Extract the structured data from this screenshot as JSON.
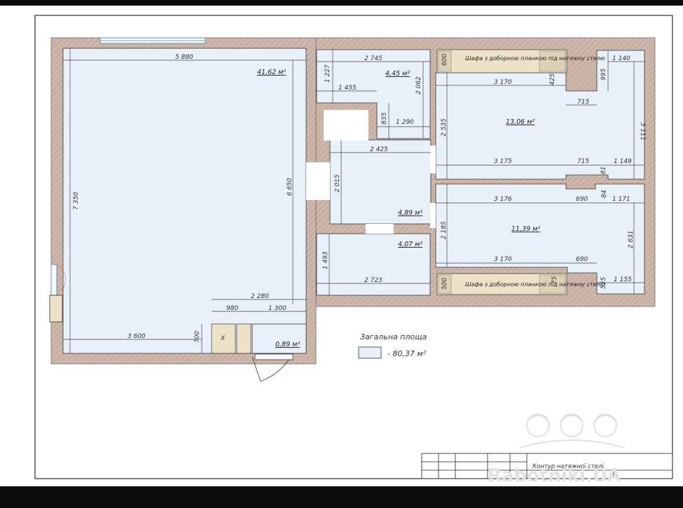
{
  "colors": {
    "wall": "#c9b2a6",
    "room": "#e8f0fa",
    "wardrobe": "#ede2c8",
    "dim_line": "#444444",
    "frame": "#000000"
  },
  "rooms": {
    "living": {
      "area": "41,62 м²",
      "w_top": "5 880",
      "h_left": "7 350",
      "h_right": "6 650",
      "w_bottom": "3 600",
      "step_w": "2 280",
      "step_a": "980",
      "step_b": "1 300",
      "step_h": "700",
      "closet_mark": "X"
    },
    "room_a": {
      "area": "4,45 м²",
      "w_top": "2 745",
      "h_left": "1 227",
      "w_mid": "1 455",
      "h_right": "2 062",
      "h_notch": "835",
      "w_bottom": "1 290"
    },
    "room_b": {
      "area": "4,89 м²",
      "w_top": "2 425",
      "h_left": "2 015"
    },
    "room_c": {
      "area": "4,07 м²",
      "h_left": "1 493",
      "w_bottom": "2 723"
    },
    "bed1": {
      "area": "13,06 м²",
      "wardrobe_h": "600",
      "wardrobe_text": "Шафа з доборною планкою під натяжну стелю",
      "w_top": "3 170",
      "notch_h": "425",
      "right_w": "1 140",
      "right_h": "995",
      "notch_w": "715",
      "h_right": "3 111",
      "h_left": "2 535",
      "w_bottom": "3 175",
      "b_notch_w": "715",
      "b_right_w": "1 149",
      "b_notch_h": "81"
    },
    "bed2": {
      "area": "11,39 м²",
      "w_top": "3 176",
      "notch_w": "690",
      "notch_h": "84",
      "right_w": "1 171",
      "h_left": "2 185",
      "h_right": "2 631",
      "w_bottom": "3 170",
      "b_notch_w": "690",
      "wardrobe_h": "500",
      "wardrobe_text": "Шафа з доборною планкою під натяжну стелю",
      "b_notch_h": "75",
      "b_right_h": "525",
      "b_right_w": "1 155"
    },
    "small": {
      "area": "0,89 м²"
    }
  },
  "legend": {
    "title": "Загальна площа",
    "value": "- 80,37 м²"
  },
  "stamp": {
    "caption": "Контур натяжної стелі"
  },
  "watermark": {
    "text": "Rabotniki.UA"
  },
  "icons": [
    "door-swing-icon",
    "window-icon",
    "hardhat-worker-icon"
  ]
}
